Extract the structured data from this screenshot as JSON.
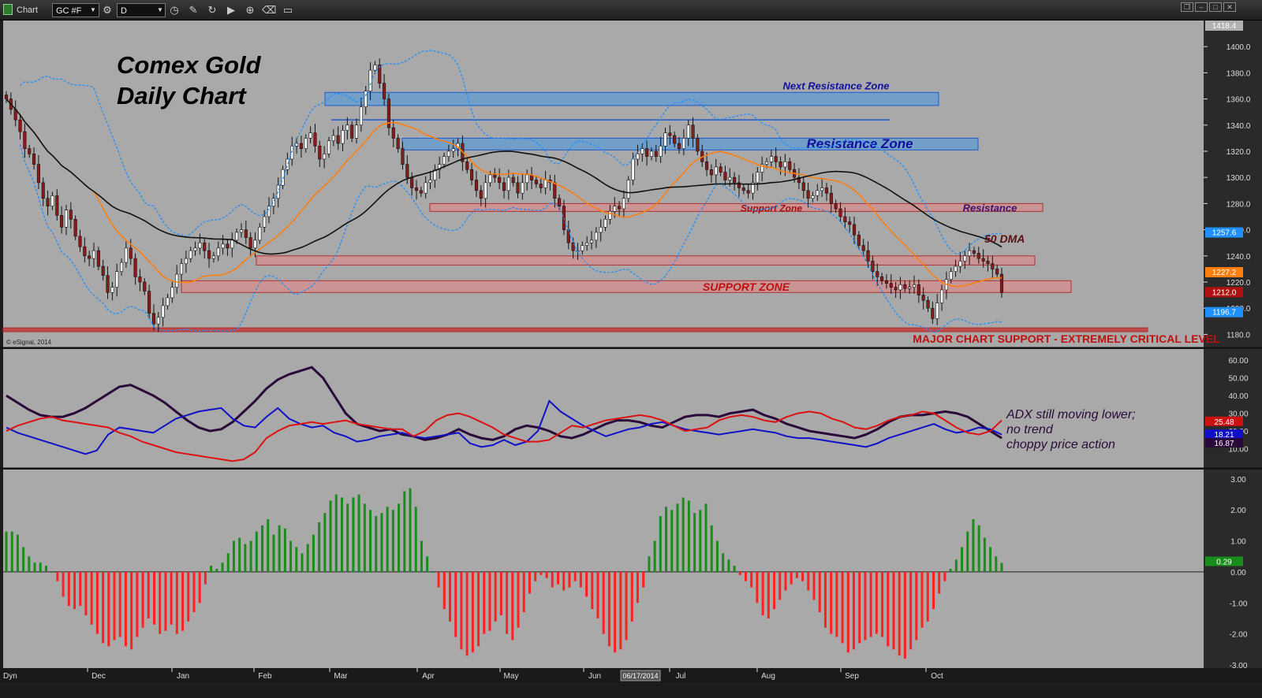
{
  "toolbar": {
    "app_title": "Chart",
    "symbol": "GC #F",
    "interval": "D",
    "icons": [
      "chart-logo-icon",
      "settings-icon",
      "clock-icon",
      "pencil-icon",
      "refresh-icon",
      "play-icon",
      "zoom-icon",
      "eraser-icon",
      "message-icon"
    ]
  },
  "window_controls": [
    "restore",
    "minimize",
    "maximize",
    "close"
  ],
  "copyright": "© eSignal, 2014",
  "bottom": {
    "dyn_label": "Dyn",
    "cursor_date": "06/17/2014"
  },
  "colors": {
    "panel_bg": "#a9a9a9",
    "candle_up": "#ffffff",
    "candle_down": "#8b1a1a",
    "ma_fast": "#ff7f0e",
    "ma_slow": "#111111",
    "bollinger": "#1e90ff",
    "resistance_fill": "#5b9bd5",
    "support_fill": "#d98c8c",
    "adx": "#2a0a3a",
    "di_plus": "#1010c8",
    "di_minus": "#dd1111",
    "hist_up": "#1a8c1a",
    "hist_down": "#ff2020"
  },
  "chart_data": [
    {
      "type": "candlestick",
      "title": "Comex Gold\nDaily Chart",
      "title_lines": [
        "Comex Gold",
        "Daily Chart"
      ],
      "ylim": [
        1170,
        1420
      ],
      "yticks": [
        1180,
        1200,
        1220,
        1240,
        1260,
        1280,
        1300,
        1320,
        1340,
        1360,
        1380,
        1400
      ],
      "xticks": [
        "Dec",
        "Jan",
        "Feb",
        "Mar",
        "Apr",
        "May",
        "Jun",
        "Jul",
        "Aug",
        "Sep",
        "Oct"
      ],
      "price_tags": [
        {
          "label": "1418.4",
          "value": 1418.4,
          "color": "#b0b0b0"
        },
        {
          "label": "1257.6",
          "value": 1257.6,
          "color": "#1e90ff"
        },
        {
          "label": "1227.2",
          "value": 1227.2,
          "color": "#ff7f0e"
        },
        {
          "label": "1212.0",
          "value": 1212.0,
          "color": "#b01010"
        },
        {
          "label": "1196.7",
          "value": 1196.7,
          "color": "#1e90ff"
        }
      ],
      "zones": [
        {
          "label": "Next Resistance Zone",
          "kind": "resistance",
          "y": [
            1355,
            1365
          ]
        },
        {
          "label": "Resistance Zone",
          "kind": "resistance",
          "y": [
            1321,
            1330
          ]
        },
        {
          "label": "Support Zone",
          "kind": "support",
          "y": [
            1274,
            1280
          ]
        },
        {
          "label": "Resistance",
          "kind": "support",
          "y": [
            1274,
            1280
          ]
        },
        {
          "label": "",
          "kind": "support",
          "y": [
            1233,
            1240
          ]
        },
        {
          "label": "SUPPORT ZONE",
          "kind": "support",
          "y": [
            1212,
            1221
          ]
        },
        {
          "label": "MAJOR CHART SUPPORT - EXTREMELY CRITICAL LEVEL",
          "kind": "major",
          "y": [
            1182,
            1185
          ]
        }
      ],
      "line_level": 1344,
      "annotations": [
        "50 DMA"
      ],
      "closes": [
        1360,
        1352,
        1344,
        1335,
        1322,
        1318,
        1310,
        1296,
        1284,
        1278,
        1286,
        1271,
        1262,
        1275,
        1268,
        1255,
        1247,
        1240,
        1238,
        1244,
        1232,
        1225,
        1212,
        1216,
        1228,
        1235,
        1246,
        1238,
        1224,
        1220,
        1213,
        1196,
        1188,
        1193,
        1202,
        1208,
        1216,
        1226,
        1234,
        1238,
        1244,
        1246,
        1250,
        1244,
        1238,
        1240,
        1246,
        1249,
        1246,
        1252,
        1258,
        1260,
        1254,
        1246,
        1252,
        1262,
        1270,
        1278,
        1284,
        1294,
        1306,
        1314,
        1324,
        1326,
        1322,
        1330,
        1334,
        1324,
        1314,
        1318,
        1328,
        1332,
        1326,
        1336,
        1340,
        1330,
        1340,
        1354,
        1366,
        1382,
        1386,
        1372,
        1360,
        1338,
        1330,
        1322,
        1310,
        1300,
        1292,
        1290,
        1288,
        1296,
        1298,
        1306,
        1310,
        1316,
        1320,
        1322,
        1326,
        1312,
        1306,
        1298,
        1290,
        1284,
        1296,
        1302,
        1300,
        1296,
        1290,
        1300,
        1296,
        1288,
        1296,
        1302,
        1298,
        1295,
        1292,
        1298,
        1296,
        1284,
        1278,
        1260,
        1250,
        1244,
        1244,
        1248,
        1250,
        1252,
        1258,
        1262,
        1268,
        1274,
        1278,
        1276,
        1284,
        1298,
        1314,
        1318,
        1322,
        1316,
        1320,
        1316,
        1324,
        1334,
        1332,
        1326,
        1322,
        1330,
        1340,
        1330,
        1320,
        1312,
        1306,
        1302,
        1308,
        1304,
        1298,
        1300,
        1296,
        1292,
        1290,
        1288,
        1296,
        1304,
        1310,
        1312,
        1316,
        1312,
        1308,
        1312,
        1306,
        1300,
        1296,
        1290,
        1284,
        1286,
        1290,
        1292,
        1288,
        1280,
        1276,
        1270,
        1266,
        1264,
        1256,
        1248,
        1244,
        1236,
        1228,
        1224,
        1221,
        1219,
        1216,
        1214,
        1218,
        1215,
        1216,
        1218,
        1210,
        1206,
        1200,
        1192,
        1204,
        1214,
        1222,
        1228,
        1232,
        1236,
        1240,
        1244,
        1242,
        1238,
        1236,
        1234,
        1230,
        1226,
        1212
      ]
    },
    {
      "type": "line",
      "indicator": "ADX / DMI",
      "ylim": [
        0,
        65
      ],
      "yticks": [
        10,
        20,
        30,
        40,
        50,
        60
      ],
      "tick_labels": [
        "10.00",
        "20.00",
        "30.00",
        "40.00",
        "50.00",
        "60.00"
      ],
      "price_tags": [
        {
          "label": "25.48",
          "value": 25.48,
          "color": "#cc1111"
        },
        {
          "label": "18.21",
          "value": 18.21,
          "color": "#1010c8"
        },
        {
          "label": "16.87",
          "value": 16.87,
          "color": "#2a0a3a"
        }
      ],
      "annotation_lines": [
        "ADX still moving lower;",
        "no trend",
        "choppy price action"
      ],
      "series": [
        {
          "key": "adx",
          "values": [
            40,
            36,
            32,
            29,
            28,
            28,
            30,
            33,
            37,
            41,
            45,
            46,
            43,
            40,
            36,
            31,
            26,
            22,
            20,
            21,
            25,
            31,
            37,
            44,
            49,
            52,
            54,
            56,
            50,
            40,
            30,
            24,
            22,
            20,
            21,
            18,
            17,
            15,
            16,
            18,
            21,
            18,
            16,
            15,
            17,
            21,
            23,
            22,
            20,
            17,
            16,
            18,
            21,
            24,
            26,
            26,
            25,
            23,
            22,
            25,
            28,
            29,
            29,
            28,
            30,
            31,
            32,
            29,
            27,
            24,
            22,
            20,
            19,
            18,
            17,
            16,
            18,
            21,
            25,
            28,
            29,
            29,
            30,
            31,
            30,
            28,
            24,
            20,
            16
          ]
        },
        {
          "key": "di_plus",
          "values": [
            22,
            19,
            17,
            15,
            13,
            11,
            9,
            7,
            9,
            18,
            22,
            21,
            20,
            19,
            23,
            27,
            29,
            31,
            32,
            33,
            27,
            23,
            22,
            28,
            33,
            27,
            24,
            22,
            23,
            19,
            17,
            14,
            15,
            17,
            18,
            19,
            17,
            16,
            17,
            18,
            19,
            13,
            11,
            12,
            15,
            12,
            14,
            20,
            37,
            31,
            27,
            23,
            20,
            17,
            19,
            21,
            22,
            24,
            25,
            23,
            21,
            20,
            19,
            18,
            19,
            20,
            21,
            20,
            19,
            17,
            16,
            16,
            15,
            14,
            13,
            12,
            11,
            13,
            16,
            18,
            20,
            22,
            24,
            21,
            19,
            20,
            22,
            21,
            18
          ]
        },
        {
          "key": "di_minus",
          "values": [
            20,
            23,
            25,
            27,
            28,
            26,
            25,
            24,
            23,
            22,
            19,
            17,
            14,
            12,
            10,
            8,
            7,
            6,
            5,
            4,
            3,
            4,
            8,
            16,
            20,
            23,
            24,
            25,
            24,
            25,
            26,
            24,
            23,
            22,
            21,
            21,
            17,
            20,
            26,
            29,
            30,
            28,
            25,
            22,
            18,
            16,
            14,
            14,
            15,
            19,
            23,
            22,
            24,
            26,
            27,
            28,
            29,
            28,
            26,
            23,
            20,
            21,
            22,
            26,
            28,
            29,
            28,
            26,
            25,
            28,
            30,
            31,
            30,
            27,
            25,
            22,
            21,
            23,
            26,
            28,
            29,
            31,
            30,
            26,
            22,
            19,
            18,
            20,
            26
          ]
        }
      ]
    },
    {
      "type": "bar",
      "indicator": "MACD Histogram",
      "ylim": [
        -3,
        3.2
      ],
      "yticks": [
        -3,
        -2,
        -1,
        0,
        1,
        2,
        3
      ],
      "tick_labels": [
        "-3.00",
        "-2.00",
        "-1.00",
        "0.00",
        "1.00",
        "2.00",
        "3.00"
      ],
      "price_tags": [
        {
          "label": "0.29",
          "value": 0.29,
          "color": "#1a8c1a"
        }
      ],
      "values": [
        1.3,
        1.3,
        1.2,
        0.8,
        0.5,
        0.3,
        0.3,
        0.2,
        0,
        -0.3,
        -0.8,
        -1.1,
        -1.2,
        -1.1,
        -1.4,
        -1.7,
        -2.0,
        -2.3,
        -2.4,
        -2.2,
        -2.1,
        -2.4,
        -2.5,
        -2.1,
        -1.8,
        -1.5,
        -1.7,
        -2.0,
        -1.9,
        -1.7,
        -2.0,
        -1.9,
        -1.6,
        -1.3,
        -1.0,
        -0.4,
        0.2,
        0.1,
        0.3,
        0.6,
        1.0,
        1.1,
        0.9,
        1.0,
        1.3,
        1.5,
        1.7,
        1.2,
        1.5,
        1.4,
        1.0,
        0.8,
        0.6,
        0.9,
        1.2,
        1.6,
        1.9,
        2.3,
        2.5,
        2.4,
        2.2,
        2.4,
        2.5,
        2.2,
        2.0,
        1.8,
        1.9,
        2.1,
        2.0,
        2.2,
        2.6,
        2.7,
        2.1,
        1.0,
        0.5,
        0,
        -0.5,
        -1.2,
        -1.6,
        -2.1,
        -2.5,
        -2.7,
        -2.6,
        -2.4,
        -2.0,
        -1.9,
        -1.6,
        -1.4,
        -2.0,
        -2.2,
        -1.8,
        -1.3,
        -0.7,
        -0.3,
        -0.1,
        -0.2,
        -0.5,
        -0.4,
        -0.6,
        -0.5,
        -0.3,
        -0.5,
        -0.8,
        -1.2,
        -1.5,
        -2.0,
        -2.4,
        -2.6,
        -2.5,
        -2.2,
        -1.6,
        -1.0,
        -0.5,
        0.5,
        1.0,
        1.8,
        2.1,
        2.0,
        2.2,
        2.4,
        2.3,
        1.9,
        2.0,
        2.2,
        1.5,
        1.0,
        0.6,
        0.4,
        0.2,
        -0.1,
        -0.3,
        -0.5,
        -1.0,
        -1.4,
        -1.5,
        -1.2,
        -0.9,
        -0.6,
        -0.4,
        -0.2,
        -0.3,
        -0.6,
        -0.9,
        -1.3,
        -1.8,
        -2.0,
        -2.1,
        -2.3,
        -2.6,
        -2.5,
        -2.3,
        -2.2,
        -2.1,
        -2.0,
        -2.1,
        -2.4,
        -2.5,
        -2.7,
        -2.8,
        -2.5,
        -2.2,
        -1.8,
        -1.6,
        -1.2,
        -0.7,
        -0.3,
        0.1,
        0.4,
        0.8,
        1.3,
        1.7,
        1.5,
        1.1,
        0.8,
        0.5,
        0.29
      ]
    }
  ]
}
